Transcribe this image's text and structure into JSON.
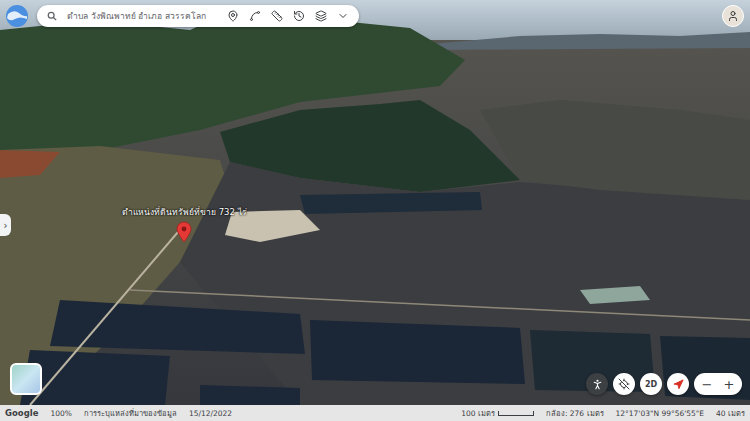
{
  "search": {
    "value": "ตำบล วังพิณพาทย์ อำเภอ สวรรคโลก"
  },
  "map": {
    "pin": {
      "label": "ตำแหน่งที่ดินทรัพย์ที่ขาย 732 ไร่"
    }
  },
  "side_tab": {
    "glyph": "›"
  },
  "map_controls": {
    "view_mode": "2D",
    "zoom": [
      "−",
      "+"
    ]
  },
  "status_bar": {
    "left": [
      "Google",
      "100%",
      "การระบุแหล่งที่มาของข้อมูล",
      "15/12/2022"
    ],
    "scale": "100 เมตร",
    "camera": "กล้อง: 276 เมตร",
    "coordinates": "12°17'03\"N 99°56'55\"E",
    "altitude": "40 เมตร"
  }
}
